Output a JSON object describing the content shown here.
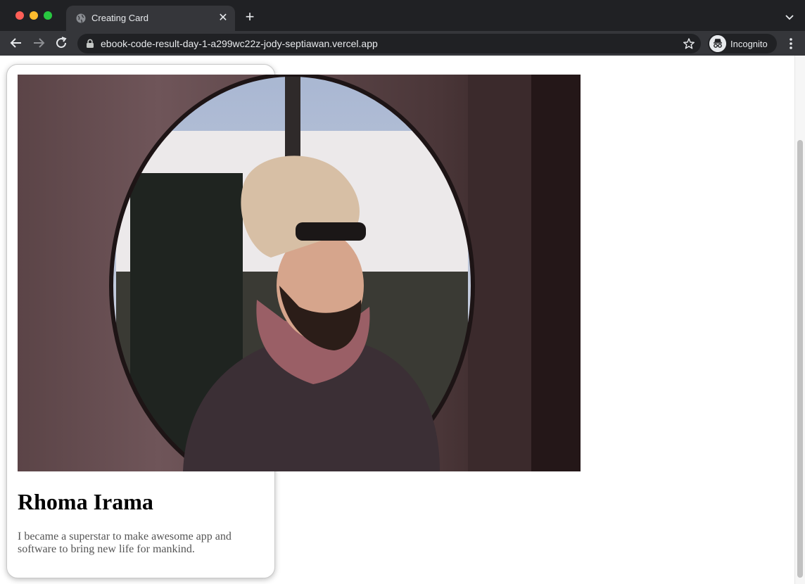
{
  "browser": {
    "tab": {
      "title": "Creating Card"
    },
    "address_bar": {
      "url": "ebook-code-result-day-1-a299wc22z-jody-septiawan.vercel.app"
    },
    "profile": {
      "label": "Incognito"
    }
  },
  "card": {
    "title": "Rhoma Irama",
    "description": "I became a superstar to make awesome app and software to bring new life for mankind."
  },
  "colors": {
    "chrome_dark": "#202124",
    "chrome_tab": "#35363a",
    "card_border": "#c9c9c9",
    "text_muted": "#555555"
  },
  "icons": {
    "back": "arrow-left-icon",
    "forward": "arrow-right-icon",
    "reload": "reload-icon",
    "lock": "lock-icon",
    "star": "star-icon",
    "incognito": "incognito-icon",
    "menu": "kebab-menu-icon"
  }
}
